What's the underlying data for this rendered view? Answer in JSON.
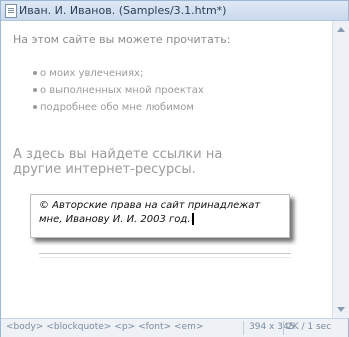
{
  "window": {
    "title": "Иван. И. Иванов. (Samples/3.1.htm*)"
  },
  "content": {
    "intro": "На этом сайте вы можете прочитать:",
    "items": [
      "о моих увлечениях;",
      "о выполненных мной проектах",
      "подробнее обо мне любимом"
    ],
    "resources": "А здесь вы найдете ссылки на другие интернет-ресурсы.",
    "copyright": "© Авторские права на сайт принадлежат мне, Иванову И. И. 2003 год."
  },
  "statusbar": {
    "tags": [
      "<body>",
      "<blockquote>",
      "<p>",
      "<font>",
      "<em>"
    ],
    "dimensions": "394 x 345",
    "size_info": "2K / 1 sec"
  }
}
